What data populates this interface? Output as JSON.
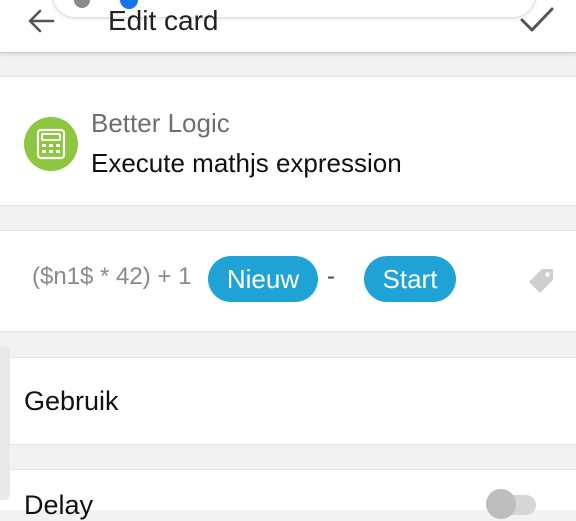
{
  "header": {
    "title": "Edit card",
    "back_icon": "arrow-left-icon",
    "confirm_icon": "checkmark-icon"
  },
  "card": {
    "app_name": "Better Logic",
    "card_name": "Execute mathjs expression",
    "app_icon": "calculator-icon",
    "app_icon_color": "#8dc63f"
  },
  "expression": {
    "text": "($n1$ * 42) + 1",
    "tag1": "Nieuw",
    "separator": "-",
    "tag2": "Start",
    "tag_color": "#1fa3d6",
    "label_icon": "tag-icon"
  },
  "settings": {
    "gebruik_label": "Gebruik",
    "delay_label": "Delay",
    "delay_enabled": false
  }
}
